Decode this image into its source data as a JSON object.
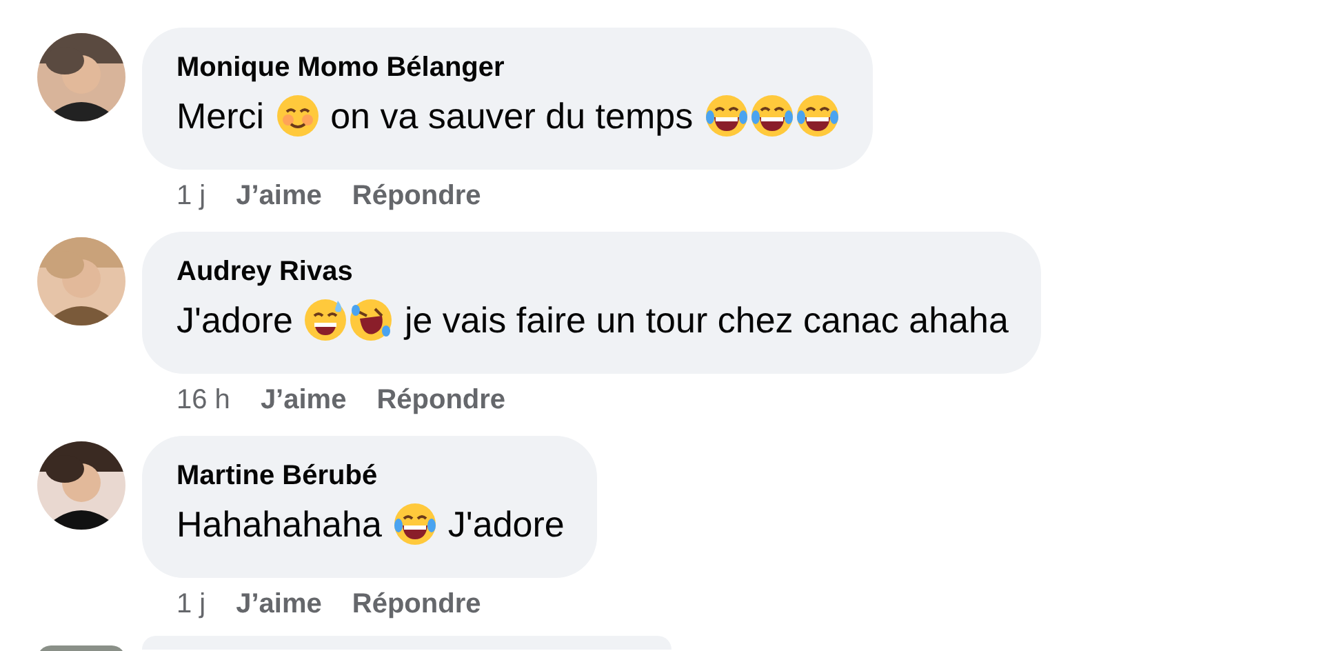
{
  "comments": [
    {
      "author": "Monique Momo Bélanger",
      "message": [
        {
          "kind": "text",
          "text": "Merci"
        },
        {
          "kind": "blush"
        },
        {
          "kind": "text",
          "text": "on va sauver du temps"
        },
        {
          "kind": "joy"
        },
        {
          "kind": "joy"
        },
        {
          "kind": "joy"
        }
      ],
      "time": "1 j",
      "like": "J’aime",
      "reply": "Répondre"
    },
    {
      "author": "Audrey Rivas",
      "message": [
        {
          "kind": "text",
          "text": "J'adore"
        },
        {
          "kind": "sweat"
        },
        {
          "kind": "rofl"
        },
        {
          "kind": "text",
          "text": "je vais faire un tour chez canac ahaha"
        }
      ],
      "time": "16 h",
      "like": "J’aime",
      "reply": "Répondre"
    },
    {
      "author": "Martine Bérubé",
      "message": [
        {
          "kind": "text",
          "text": "Hahahahaha"
        },
        {
          "kind": "joy"
        },
        {
          "kind": "text",
          "text": "J'adore"
        }
      ],
      "time": "1 j",
      "like": "J’aime",
      "reply": "Répondre"
    }
  ]
}
